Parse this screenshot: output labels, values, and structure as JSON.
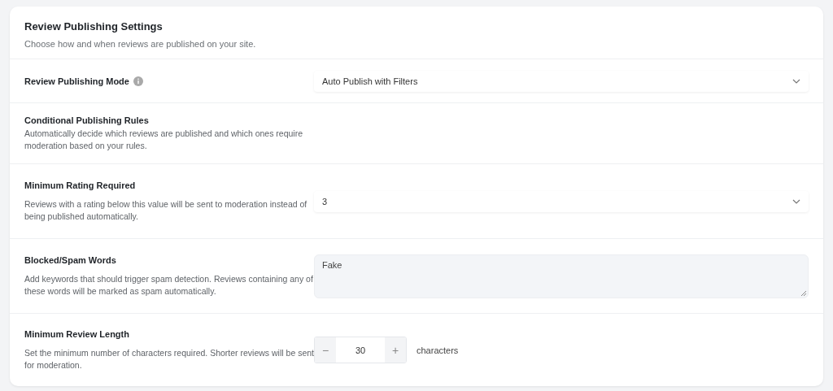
{
  "header": {
    "title": "Review Publishing Settings",
    "subtitle": "Choose how and when reviews are published on your site."
  },
  "settings": [
    {
      "kind": "select",
      "label": "Review Publishing Mode",
      "info": true,
      "value": "Auto Publish with Filters"
    },
    {
      "kind": "section",
      "label": "Conditional Publishing Rules",
      "description": "Automatically decide which reviews are published and which ones require moderation based on your rules."
    },
    {
      "kind": "select",
      "label": "Minimum Rating Required",
      "description": "Reviews with a rating below this value will be sent to moderation instead of being published automatically.",
      "value": "3"
    },
    {
      "kind": "textarea",
      "label": "Blocked/Spam Words",
      "description": "Add keywords that should trigger spam detection. Reviews containing any of these words will be marked as spam automatically.",
      "value": "Fake"
    },
    {
      "kind": "stepper",
      "label": "Minimum Review Length",
      "description": "Set the minimum number of characters required. Shorter reviews will be sent for moderation.",
      "decrement": "−",
      "value": "30",
      "increment": "+",
      "unit": "characters"
    }
  ]
}
